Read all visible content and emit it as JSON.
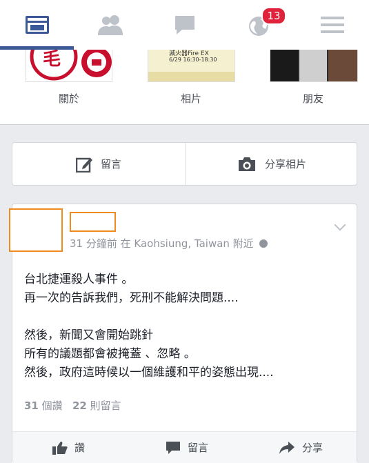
{
  "nav": {
    "items": [
      {
        "name": "news-feed",
        "active": true
      },
      {
        "name": "friend-requests"
      },
      {
        "name": "messages"
      },
      {
        "name": "notifications",
        "badge": "13"
      },
      {
        "name": "more-menu"
      }
    ],
    "accent_color": "#3b5998",
    "badge_color": "#e0223a"
  },
  "profile_strip": {
    "about_label": "關於",
    "photos_label": "相片",
    "friends_label": "朋友",
    "photos_thumb_text_1": "滅火器Fire EX",
    "photos_thumb_text_2": "6/29 16:30-18:30"
  },
  "composer": {
    "post_label": "留言",
    "photo_label": "分享相片"
  },
  "post": {
    "meta_time": "31 分鐘前",
    "meta_location": "在 Kaohsiung, Taiwan 附近",
    "lines": [
      "台北捷運殺人事件 。",
      "再一次的告訴我們，死刑不能解決問題....",
      "",
      "然後，新聞又會開始跳針",
      "所有的議題都會被掩蓋 、忽略 。",
      "然後，政府這時候以一個維護和平的姿態出現...."
    ],
    "likes_count": "31",
    "likes_label": "個讚",
    "comments_count": "22",
    "comments_label": "則留言",
    "action_like": "讚",
    "action_comment": "留言",
    "action_share": "分享"
  }
}
